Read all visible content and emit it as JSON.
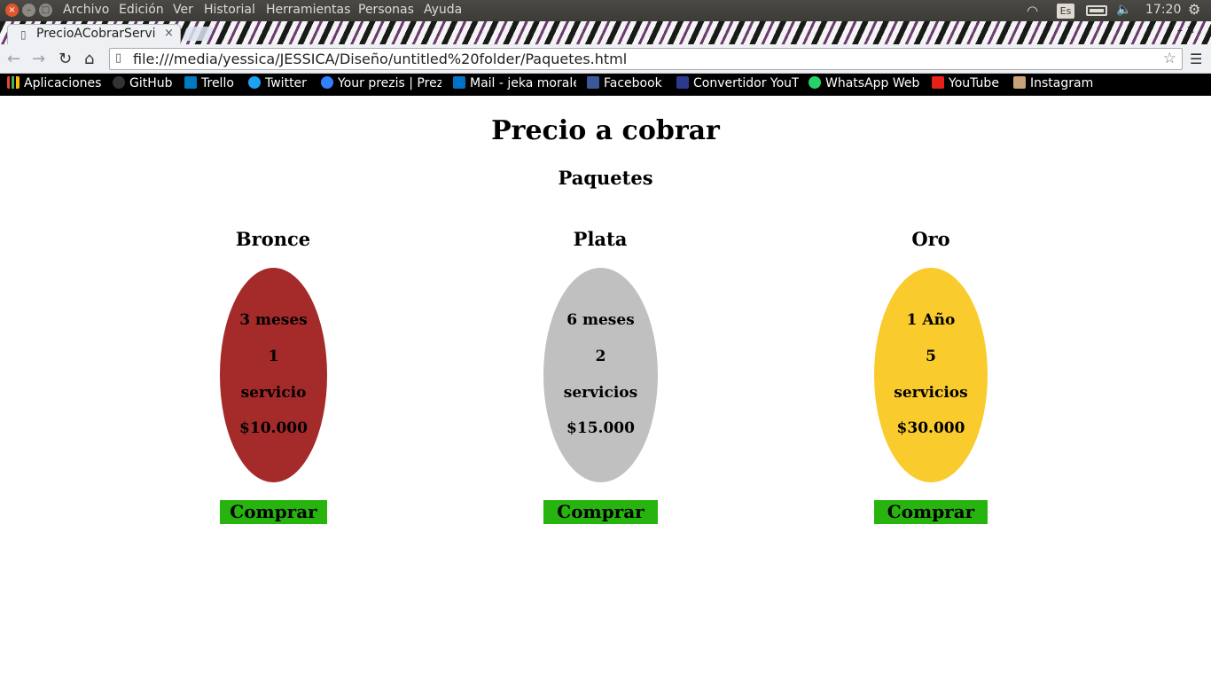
{
  "os": {
    "menu": [
      "Archivo",
      "Edición",
      "Ver",
      "Historial",
      "Herramientas",
      "Personas",
      "Ayuda"
    ],
    "keyboard": "Es",
    "time": "17:20"
  },
  "browser": {
    "tab_title": "PrecioACobrarServi",
    "url": "file:///media/yessica/JESSICA/Diseño/untitled%20folder/Paquetes.html",
    "bookmarks": [
      {
        "label": "Aplicaciones",
        "icon": "apps-grid-icon",
        "color": "#e8453c"
      },
      {
        "label": "GitHub",
        "icon": "github-icon",
        "color": "#333333"
      },
      {
        "label": "Trello",
        "icon": "trello-icon",
        "color": "#0079bf"
      },
      {
        "label": "Twitter",
        "icon": "twitter-icon",
        "color": "#1da1f2"
      },
      {
        "label": "Your prezis | Prez",
        "icon": "prezi-icon",
        "color": "#3181ff"
      },
      {
        "label": "Mail - jeka morale",
        "icon": "mail-icon",
        "color": "#0072c6"
      },
      {
        "label": "Facebook",
        "icon": "facebook-icon",
        "color": "#3b5998"
      },
      {
        "label": "Convertidor YouT",
        "icon": "converter-icon",
        "color": "#2b3a8c"
      },
      {
        "label": "WhatsApp Web",
        "icon": "whatsapp-icon",
        "color": "#25d366"
      },
      {
        "label": "YouTube",
        "icon": "youtube-icon",
        "color": "#e62117"
      },
      {
        "label": "Instagram",
        "icon": "instagram-icon",
        "color": "#c8a27a"
      }
    ]
  },
  "page": {
    "title": "Precio a cobrar",
    "subtitle": "Paquetes",
    "packages": [
      {
        "name": "Bronce",
        "duration": "3 meses",
        "count": "1",
        "unit": "servicio",
        "price": "$10.000",
        "color": "#a52a2a",
        "button": "Comprar"
      },
      {
        "name": "Plata",
        "duration": "6 meses",
        "count": "2",
        "unit": "servicios",
        "price": "$15.000",
        "color": "#c0c0c0",
        "button": "Comprar"
      },
      {
        "name": "Oro",
        "duration": "1 Año",
        "count": "5",
        "unit": "servicios",
        "price": "$30.000",
        "color": "#f9cb2d",
        "button": "Comprar"
      }
    ],
    "button_color": "#27b40f"
  }
}
